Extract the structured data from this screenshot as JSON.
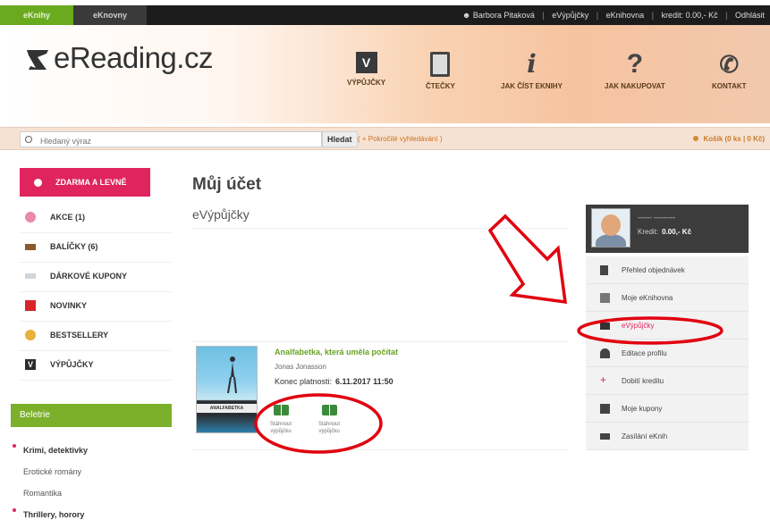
{
  "topbar": {
    "tabs": [
      "eKnihy",
      "eKnovny"
    ],
    "user": "Barbora Pitaková",
    "links": [
      "eVýpůjčky",
      "eKnihovna",
      "kredit: 0.00,- Kč",
      "Odhlásit"
    ]
  },
  "header": {
    "logo": "eReading.cz",
    "nav": [
      "VÝPŮJČKY",
      "ČTEČKY",
      "JAK ČÍST EKNIHY",
      "JAK NAKUPOVAT",
      "KONTAKT"
    ]
  },
  "search": {
    "placeholder": "Hledaný výraz",
    "button": "Hledat",
    "help": "( + Pokročilé vyhledávání )",
    "cart": "Košík (0 ks | 0 Kč)"
  },
  "sidebar": {
    "free": "ZDARMA A LEVNĚ",
    "items": [
      "AKCE (1)",
      "BALÍČKY (6)",
      "DÁRKOVÉ KUPONY",
      "NOVINKY",
      "BESTSELLERY",
      "VÝPŮJČKY"
    ],
    "category": "Beletrie",
    "subcategories": [
      "Krimi, detektivky",
      "Erotické romány",
      "Romantika",
      "Thrillery, horory"
    ]
  },
  "main": {
    "title": "Můj účet",
    "section": "eVýpůjčky",
    "book": {
      "title": "Analfabetka, která uměla počítat",
      "author": "Jonas Jonasson",
      "validity_label": "Konec platnosti:",
      "validity_value": "6.11.2017 11:50",
      "cover_text": "ANALFABETKA",
      "downloads": [
        {
          "label": "Stáhnout výpůjčku"
        },
        {
          "label": "Stáhnout výpůjčku"
        }
      ]
    }
  },
  "account": {
    "name": "------ ---------",
    "credit_label": "Kredit:",
    "credit_value": "0.00,- Kč",
    "menu": [
      "Přehled objednávek",
      "Moje eKnihovna",
      "eVýpůjčky",
      "Editace profilu",
      "Dobití kreditu",
      "Moje kupony",
      "Zasílání eKnih"
    ]
  },
  "colors": {
    "brand_green": "#6aaa1f",
    "accent_pink": "#e0245e",
    "annotation_red": "#e1000f"
  }
}
